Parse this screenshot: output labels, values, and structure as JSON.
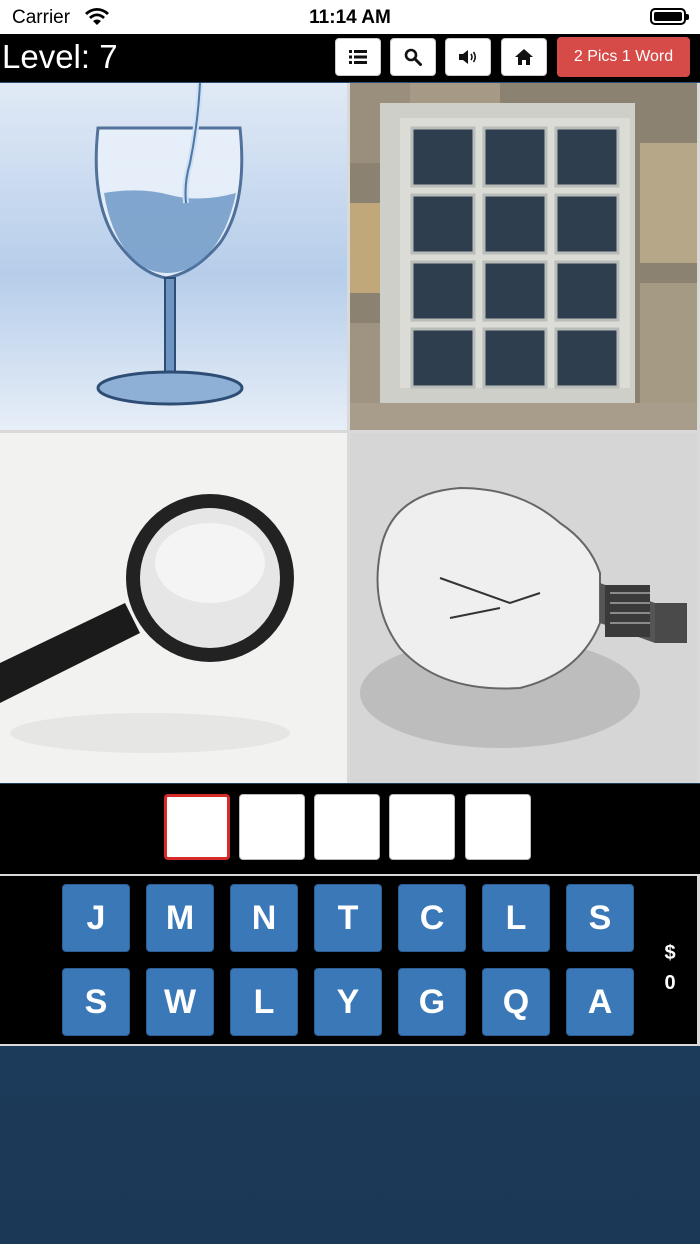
{
  "status": {
    "carrier": "Carrier",
    "time": "11:14 AM"
  },
  "header": {
    "level_text": "Level: 7",
    "tools": [
      "list-icon",
      "search-icon",
      "sound-icon",
      "home-icon"
    ],
    "brand": "2 Pics 1 Word"
  },
  "pictures": [
    "wine-glass-water",
    "glass-block-window",
    "magnifying-glass",
    "light-bulb"
  ],
  "answer": {
    "slots": [
      "",
      "",
      "",
      "",
      ""
    ]
  },
  "keyboard": {
    "row1": [
      "J",
      "M",
      "N",
      "T",
      "C",
      "L",
      "S"
    ],
    "row2": [
      "S",
      "W",
      "L",
      "Y",
      "G",
      "Q",
      "A"
    ]
  },
  "coins": {
    "symbol": "$",
    "amount": "0"
  },
  "colors": {
    "key": "#3a78b8",
    "brand": "#d64a47",
    "active_slot": "#d62b2b"
  }
}
